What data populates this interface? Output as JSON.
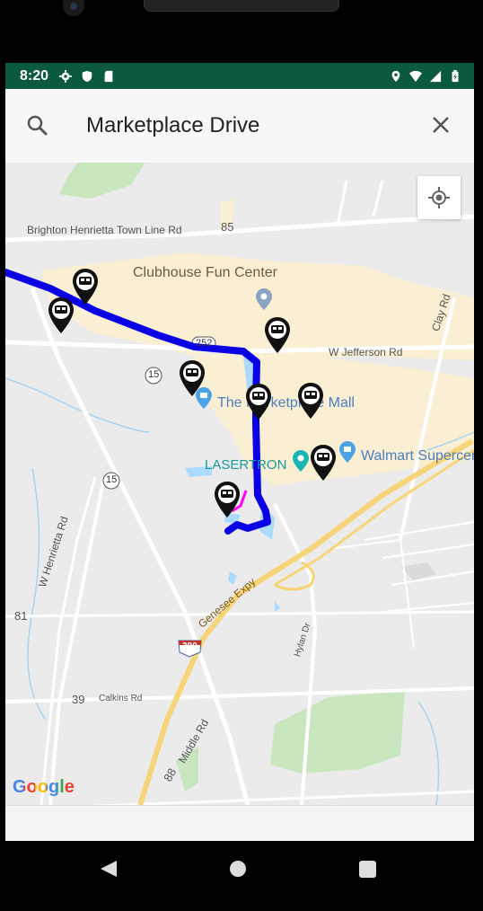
{
  "status": {
    "time": "8:20",
    "left_icons": [
      "gear-icon",
      "shield-icon",
      "sd-card-icon"
    ],
    "right_icons": [
      "location-icon",
      "wifi-icon",
      "signal-icon",
      "battery-icon"
    ]
  },
  "search": {
    "query": "Marketplace Drive"
  },
  "map": {
    "roads": {
      "brighton_henrietta": "Brighton Henrietta Town Line Rd",
      "route_85": "85",
      "w_jefferson": "W Jefferson Rd",
      "route_252": "252",
      "route_15_a": "15",
      "route_15_b": "15",
      "clay_rd": "Clay Rd",
      "w_henrietta": "W Henrietta Rd",
      "route_81": "81",
      "genesee_expy": "Genesee Expy",
      "route_390": "390",
      "hylan_dr": "Hylan Dr",
      "calkins_rd": "Calkins Rd",
      "route_39": "39",
      "middle_rd": "Middle Rd",
      "route_88": "88"
    },
    "pois": {
      "clubhouse": "Clubhouse Fun Center",
      "mall": "The Marketplace Mall",
      "lasertron": "LASERTRON",
      "walmart": "Walmart Supercenter"
    },
    "route_color": "#0a00e6",
    "route_accent_color": "#ff00ff",
    "pin_icon": "bus-stop-pin-icon",
    "attribution": "Google"
  },
  "nav": {
    "back_icon": "back-triangle-icon",
    "home_icon": "home-circle-icon",
    "recents_icon": "recents-square-icon"
  }
}
